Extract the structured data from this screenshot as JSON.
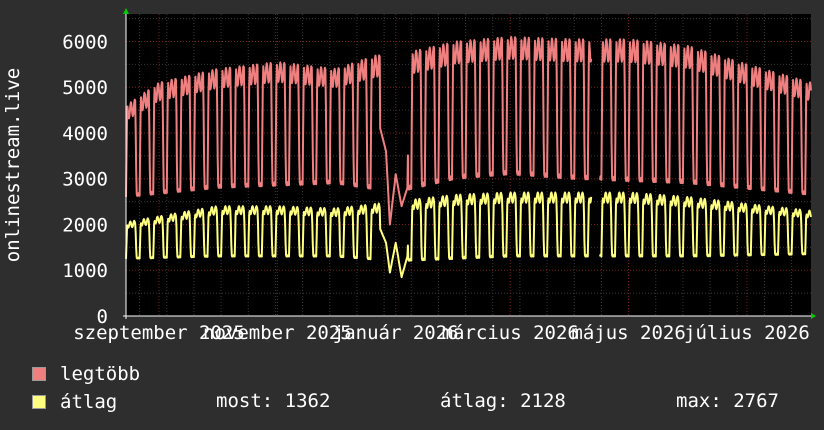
{
  "chart_data": {
    "type": "line",
    "ylabel": "onlinestream.live",
    "ylim": [
      0,
      6600
    ],
    "yticks": [
      0,
      1000,
      2000,
      3000,
      4000,
      5000,
      6000
    ],
    "xticks": [
      {
        "label": "szeptember 2025",
        "date": "2025-09-01"
      },
      {
        "label": "november 2025",
        "date": "2025-11-01"
      },
      {
        "label": "január 2026",
        "date": "2026-01-01"
      },
      {
        "label": "március 2026",
        "date": "2026-03-01"
      },
      {
        "label": "május 2026",
        "date": "2026-05-01"
      },
      {
        "label": "július 2026",
        "date": "2026-07-01"
      }
    ],
    "x_start": "2025-08-15",
    "x_end": "2026-08-03",
    "grid": true,
    "series": [
      {
        "name": "legtöbb",
        "color": "#f08080",
        "weekly_peaks": [
          [
            "2025-08-15",
            4600
          ],
          [
            "2025-09-01",
            5100
          ],
          [
            "2025-10-01",
            5400
          ],
          [
            "2025-11-01",
            5550
          ],
          [
            "2025-12-01",
            5400
          ],
          [
            "2025-12-22",
            5700
          ],
          [
            "2026-01-01",
            5700
          ],
          [
            "2026-02-01",
            6000
          ],
          [
            "2026-03-01",
            6100
          ],
          [
            "2026-04-01",
            6050
          ],
          [
            "2026-05-01",
            6050
          ],
          [
            "2026-06-01",
            5900
          ],
          [
            "2026-07-01",
            5500
          ],
          [
            "2026-08-03",
            5100
          ]
        ],
        "weekly_troughs": [
          [
            "2025-08-15",
            2600
          ],
          [
            "2025-10-01",
            2800
          ],
          [
            "2025-12-01",
            2900
          ],
          [
            "2026-01-01",
            2700
          ],
          [
            "2026-02-01",
            3000
          ],
          [
            "2026-03-01",
            3100
          ],
          [
            "2026-04-01",
            3000
          ],
          [
            "2026-06-01",
            2900
          ],
          [
            "2026-08-03",
            2650
          ]
        ],
        "holiday_dip": [
          [
            "2025-12-24",
            4100
          ],
          [
            "2025-12-27",
            3600
          ],
          [
            "2025-12-29",
            2000
          ],
          [
            "2026-01-01",
            3100
          ],
          [
            "2026-01-04",
            2400
          ],
          [
            "2026-01-07",
            2800
          ]
        ],
        "gaps": [
          [
            "2026-04-12",
            "2026-04-16"
          ]
        ]
      },
      {
        "name": "átlag",
        "color": "#ffff80",
        "weekly_peaks": [
          [
            "2025-08-15",
            2050
          ],
          [
            "2025-10-01",
            2400
          ],
          [
            "2025-11-01",
            2400
          ],
          [
            "2025-12-01",
            2350
          ],
          [
            "2026-01-01",
            2500
          ],
          [
            "2026-02-01",
            2650
          ],
          [
            "2026-03-01",
            2700
          ],
          [
            "2026-04-01",
            2700
          ],
          [
            "2026-05-01",
            2700
          ],
          [
            "2026-06-01",
            2600
          ],
          [
            "2026-07-01",
            2450
          ],
          [
            "2026-08-03",
            2300
          ]
        ],
        "weekly_troughs": [
          [
            "2025-08-15",
            1250
          ],
          [
            "2025-10-01",
            1300
          ],
          [
            "2025-12-01",
            1300
          ],
          [
            "2026-01-01",
            1200
          ],
          [
            "2026-02-01",
            1250
          ],
          [
            "2026-03-01",
            1300
          ],
          [
            "2026-04-01",
            1300
          ],
          [
            "2026-06-01",
            1300
          ],
          [
            "2026-08-03",
            1350
          ]
        ],
        "holiday_dip": [
          [
            "2025-12-24",
            1900
          ],
          [
            "2025-12-27",
            1600
          ],
          [
            "2025-12-29",
            950
          ],
          [
            "2026-01-01",
            1600
          ],
          [
            "2026-01-04",
            850
          ],
          [
            "2026-01-07",
            1300
          ]
        ],
        "gaps": [
          [
            "2026-04-12",
            "2026-04-16"
          ]
        ]
      }
    ]
  },
  "legend": {
    "max_label": "legtöbb",
    "avg_label": "átlag",
    "max_color": "#f08080",
    "avg_color": "#ffff80"
  },
  "stats": {
    "current": "most: 1362",
    "average": "átlag: 2128",
    "maximum": "max: 2767"
  }
}
